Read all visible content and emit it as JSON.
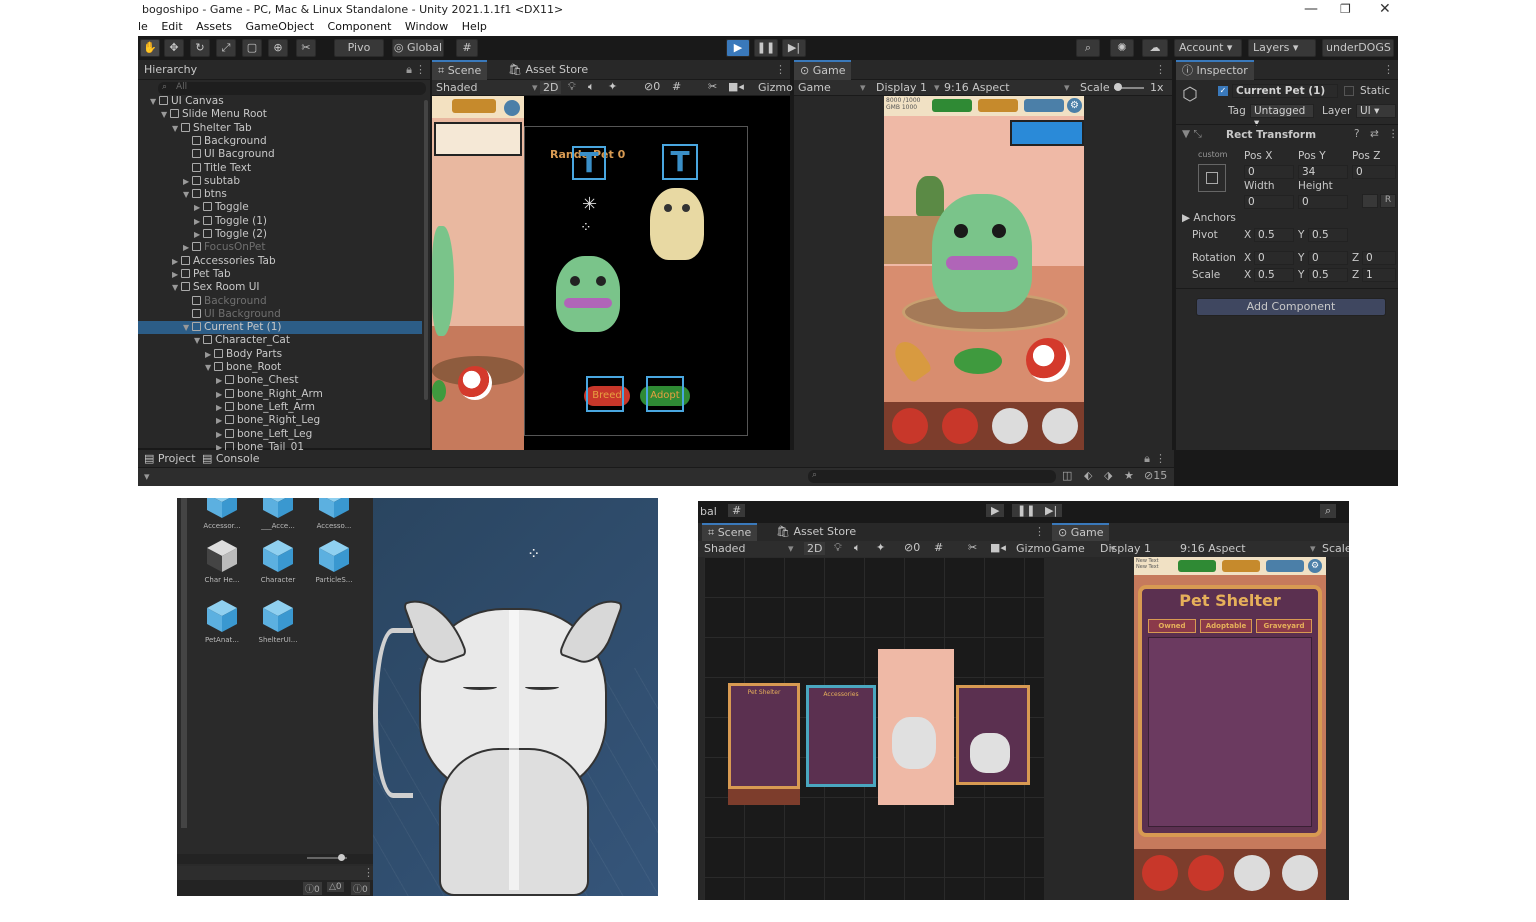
{
  "window": {
    "title": "bogoshipo - Game - PC, Mac & Linux Standalone - Unity 2021.1.1f1 <DX11>",
    "minimize": "—",
    "maximize": "❐",
    "close": "✕"
  },
  "menu": [
    "le",
    "Edit",
    "Assets",
    "GameObject",
    "Component",
    "Window",
    "Help"
  ],
  "toolbar": {
    "pivot_label": "Pivo",
    "global_label": "Global",
    "account_label": "Account",
    "layers_label": "Layers",
    "layout_label": "underDOGS"
  },
  "hierarchy": {
    "tab": "Hierarchy",
    "search_placeholder": "All",
    "rows": [
      {
        "label": "UI Canvas",
        "indent": 2,
        "arrow": "▼",
        "state": "normal"
      },
      {
        "label": "Slide Menu Root",
        "indent": 3,
        "arrow": "▼",
        "state": "normal"
      },
      {
        "label": "Shelter Tab",
        "indent": 4,
        "arrow": "▼",
        "state": "normal"
      },
      {
        "label": "Background",
        "indent": 5,
        "arrow": "",
        "state": "normal"
      },
      {
        "label": "UI Bacground",
        "indent": 5,
        "arrow": "",
        "state": "normal"
      },
      {
        "label": "Title Text",
        "indent": 5,
        "arrow": "",
        "state": "normal"
      },
      {
        "label": "subtab",
        "indent": 5,
        "arrow": "▶",
        "state": "normal"
      },
      {
        "label": "btns",
        "indent": 5,
        "arrow": "▼",
        "state": "normal"
      },
      {
        "label": "Toggle",
        "indent": 6,
        "arrow": "▶",
        "state": "normal"
      },
      {
        "label": "Toggle (1)",
        "indent": 6,
        "arrow": "▶",
        "state": "normal"
      },
      {
        "label": "Toggle (2)",
        "indent": 6,
        "arrow": "▶",
        "state": "normal"
      },
      {
        "label": "FocusOnPet",
        "indent": 5,
        "arrow": "▶",
        "state": "dim"
      },
      {
        "label": "Accessories Tab",
        "indent": 4,
        "arrow": "▶",
        "state": "normal"
      },
      {
        "label": "Pet Tab",
        "indent": 4,
        "arrow": "▶",
        "state": "normal"
      },
      {
        "label": "Sex Room UI",
        "indent": 4,
        "arrow": "▼",
        "state": "normal"
      },
      {
        "label": "Background",
        "indent": 5,
        "arrow": "",
        "state": "dim"
      },
      {
        "label": "UI Background",
        "indent": 5,
        "arrow": "",
        "state": "dim"
      },
      {
        "label": "Current Pet (1)",
        "indent": 5,
        "arrow": "▼",
        "state": "selected"
      },
      {
        "label": "Character_Cat",
        "indent": 6,
        "arrow": "▼",
        "state": "normal"
      },
      {
        "label": "Body Parts",
        "indent": 7,
        "arrow": "▶",
        "state": "normal"
      },
      {
        "label": "bone_Root",
        "indent": 7,
        "arrow": "▼",
        "state": "normal"
      },
      {
        "label": "bone_Chest",
        "indent": 8,
        "arrow": "▶",
        "state": "normal"
      },
      {
        "label": "bone_Right_Arm",
        "indent": 8,
        "arrow": "▶",
        "state": "normal"
      },
      {
        "label": "bone_Left_Arm",
        "indent": 8,
        "arrow": "▶",
        "state": "normal"
      },
      {
        "label": "bone_Right_Leg",
        "indent": 8,
        "arrow": "▶",
        "state": "normal"
      },
      {
        "label": "bone_Left_Leg",
        "indent": 8,
        "arrow": "▶",
        "state": "normal"
      },
      {
        "label": "bone_Tail_01",
        "indent": 8,
        "arrow": "▶",
        "state": "normal"
      }
    ]
  },
  "scene": {
    "tab": "Scene",
    "asset_store_tab": "Asset Store",
    "shading": "Shaded",
    "mode_2d": "2D",
    "hidden_count": "0",
    "gizmos": "Gizmo",
    "label_random_pet": "Rando  Pet 0",
    "btn_breed": "Breed",
    "btn_adopt": "Adopt",
    "t_glyph": "T"
  },
  "game": {
    "tab": "Game",
    "mode": "Game",
    "display": "Display 1",
    "aspect": "9:16 Aspect",
    "scale_label": "Scale",
    "scale_value": "1x",
    "hud_line1": "8000 /1000",
    "hud_line2": "GMB 1000"
  },
  "inspector": {
    "tab": "Inspector",
    "object_name": "Current Pet (1)",
    "static_label": "Static",
    "tag_label": "Tag",
    "tag_value": "Untagged",
    "layer_label": "Layer",
    "layer_value": "UI",
    "component": "Rect Transform",
    "anchor_preset": "custom",
    "pos_x_label": "Pos X",
    "pos_y_label": "Pos Y",
    "pos_z_label": "Pos Z",
    "pos_x": "0",
    "pos_y": "34",
    "pos_z": "0",
    "width_label": "Width",
    "height_label": "Height",
    "width": "0",
    "height": "0",
    "anchors_label": "Anchors",
    "pivot_label": "Pivot",
    "pivot_x": "0.5",
    "pivot_y": "0.5",
    "rotation_label": "Rotation",
    "rot_x": "0",
    "rot_y": "0",
    "rot_z": "0",
    "scale_label": "Scale",
    "scale_x": "0.5",
    "scale_y": "0.5",
    "scale_z": "1",
    "add_component": "Add Component",
    "x": "X",
    "y": "Y",
    "z": "Z",
    "r_button": "R"
  },
  "bottom": {
    "project_tab": "Project",
    "console_tab": "Console",
    "hidden_count": "15"
  },
  "project_assets": [
    {
      "label": "Accessor..."
    },
    {
      "label": "___Acce..."
    },
    {
      "label": "Accesso..."
    },
    {
      "label": "Char He..."
    },
    {
      "label": "Character"
    },
    {
      "label": "ParticleS..."
    },
    {
      "label": "PetAnat..."
    },
    {
      "label": "ShelterUI..."
    }
  ],
  "console_counts": {
    "a": "0",
    "b": "0",
    "c": "0"
  },
  "shot3": {
    "tab_left": "bal",
    "scene_tab": "Scene",
    "asset_store_tab": "Asset Store",
    "game_tab": "Game",
    "shading": "Shaded",
    "mode_2d": "2D",
    "hidden": "0",
    "gizmos": "Gizmo",
    "game_mode": "Game",
    "display": "Display 1",
    "aspect": "9:16 Aspect",
    "scale": "Scale",
    "title": "Pet Shelter",
    "tabs": [
      "Owned",
      "Adoptable",
      "Graveyard"
    ],
    "mini_title1": "Pet Shelter",
    "mini_title2": "Accessories",
    "hud_line1": "New Text",
    "hud_line2": "New Text"
  },
  "colors": {
    "accent": "#3a79bb",
    "selection": "#2c5d87",
    "panel": "#282828",
    "shelter_frame": "#d89a52",
    "shelter_bg": "#5b3050"
  }
}
